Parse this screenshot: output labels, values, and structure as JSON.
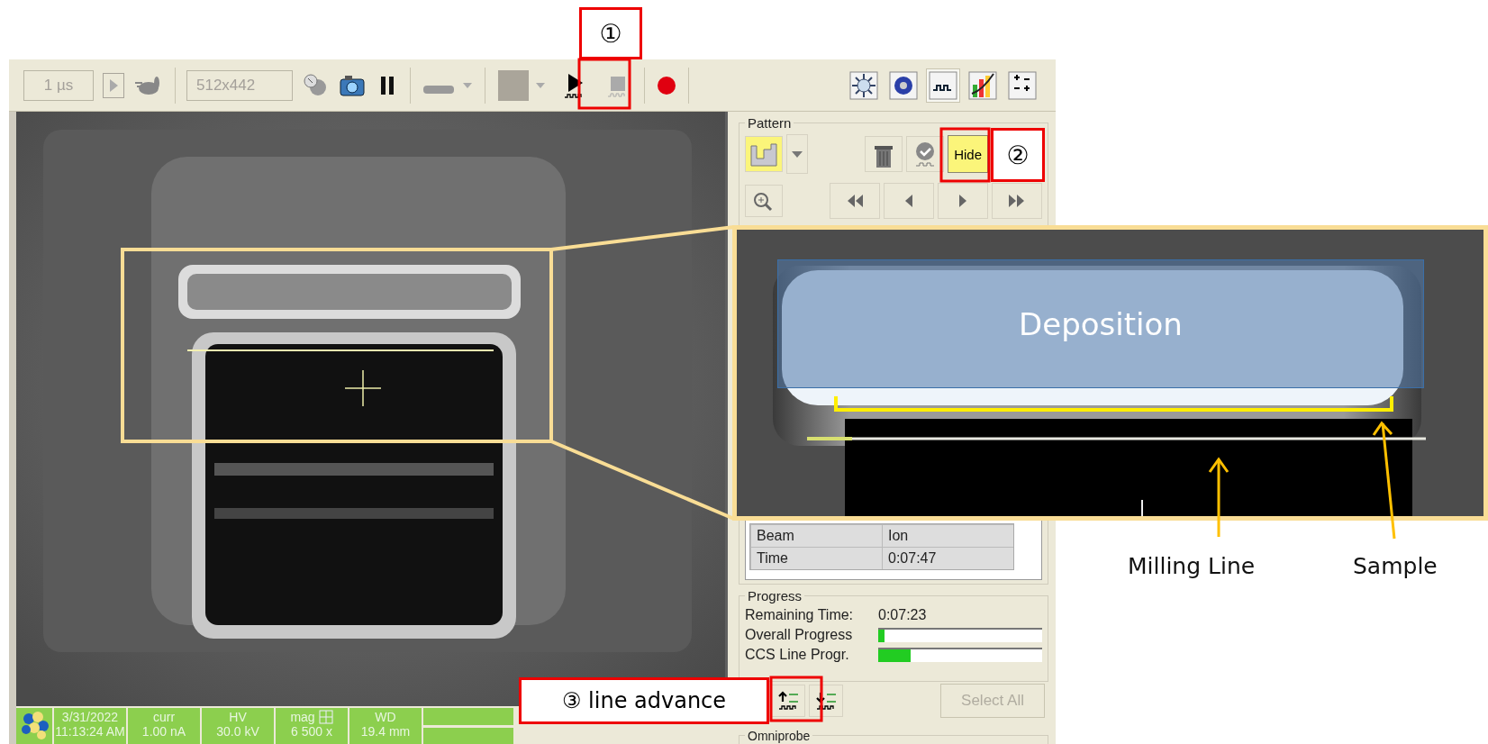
{
  "toolbar": {
    "dwell": "1 µs",
    "resolution": "512x442"
  },
  "panel_tabs": [
    {
      "selected": false
    },
    {
      "selected": false
    },
    {
      "selected": true
    },
    {
      "selected": false
    },
    {
      "selected": false
    }
  ],
  "pattern_panel": {
    "title": "Pattern",
    "tool_selected": true,
    "hide_button": {
      "label": "Hide",
      "active": true
    }
  },
  "properties": [
    {
      "name": "Beam",
      "value": "Ion"
    },
    {
      "name": "Time",
      "value": "0:07:47"
    }
  ],
  "progress": {
    "title": "Progress",
    "remaining_label": "Remaining Time:",
    "remaining_value": "0:07:23",
    "bars": [
      {
        "label": "Overall Progress",
        "level": 0.04
      },
      {
        "label": "CCS Line Progr.",
        "level": 0.2
      }
    ]
  },
  "select_all": {
    "label": "Select All",
    "disabled": true
  },
  "omniprobe": {
    "title": "Omniprobe"
  },
  "status_bar": [
    {
      "label": "3/31/2022",
      "value": "11:13:24 AM"
    },
    {
      "label": "curr",
      "value": "1.00 nA"
    },
    {
      "label": "HV",
      "value": "30.0 kV"
    },
    {
      "label": "mag",
      "value": "6 500 x",
      "grid": true
    },
    {
      "label": "WD",
      "value": "19.4 mm"
    }
  ],
  "callouts": [
    "①",
    "②",
    "③ line advance"
  ],
  "inset": {
    "deposition_label": "Deposition",
    "annotations": [
      "Milling Line",
      "Sample"
    ]
  }
}
